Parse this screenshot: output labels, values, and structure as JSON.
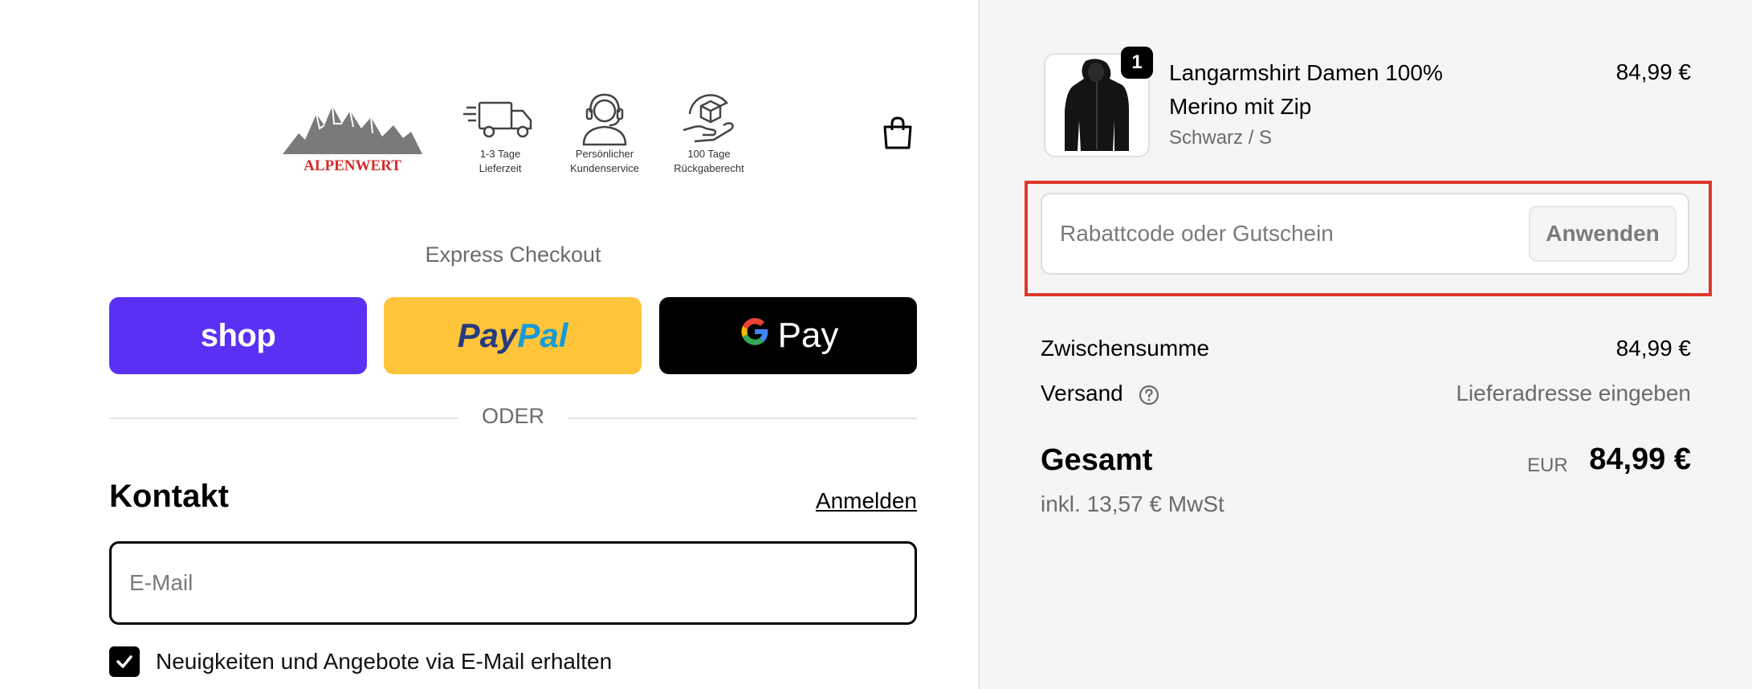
{
  "header": {
    "brand_name": "ALPENWERT",
    "features": [
      {
        "icon": "delivery-truck-icon",
        "line1": "1-3 Tage",
        "line2": "Lieferzeit"
      },
      {
        "icon": "headset-support-icon",
        "line1": "Persönlicher",
        "line2": "Kundenservice"
      },
      {
        "icon": "return-box-icon",
        "line1": "100 Tage",
        "line2": "Rückgaberecht"
      }
    ],
    "cart_icon": "shopping-bag-icon"
  },
  "express_checkout": {
    "title": "Express Checkout",
    "buttons": [
      {
        "name": "shop",
        "label": "shop",
        "color": "#5a31f4"
      },
      {
        "name": "paypal",
        "label_part1": "Pay",
        "label_part2": "Pal",
        "color": "#ffc439"
      },
      {
        "name": "gpay",
        "label_g": "G",
        "label": "Pay",
        "color": "#000000"
      }
    ],
    "divider_text": "ODER"
  },
  "contact": {
    "heading": "Kontakt",
    "login_link": "Anmelden",
    "email_placeholder": "E-Mail",
    "email_value": "",
    "newsletter_label": "Neuigkeiten und Angebote via E-Mail erhalten",
    "newsletter_checked": true
  },
  "order_summary": {
    "product": {
      "name": "Langarmshirt Damen 100% Merino mit Zip",
      "variant": "Schwarz / S",
      "price": "84,99 €",
      "quantity": "1"
    },
    "discount": {
      "placeholder": "Rabattcode oder Gutschein",
      "value": "",
      "apply_label": "Anwenden"
    },
    "subtotal_label": "Zwischensumme",
    "subtotal_value": "84,99 €",
    "shipping_label": "Versand",
    "shipping_value": "Lieferadresse eingeben",
    "total_label": "Gesamt",
    "total_currency": "EUR",
    "total_value": "84,99 €",
    "tax_note": "inkl. 13,57 € MwSt"
  },
  "colors": {
    "highlight": "#e0362c",
    "shop_pay": "#5a31f4",
    "paypal": "#ffc439",
    "brand_red": "#d42b2b"
  }
}
